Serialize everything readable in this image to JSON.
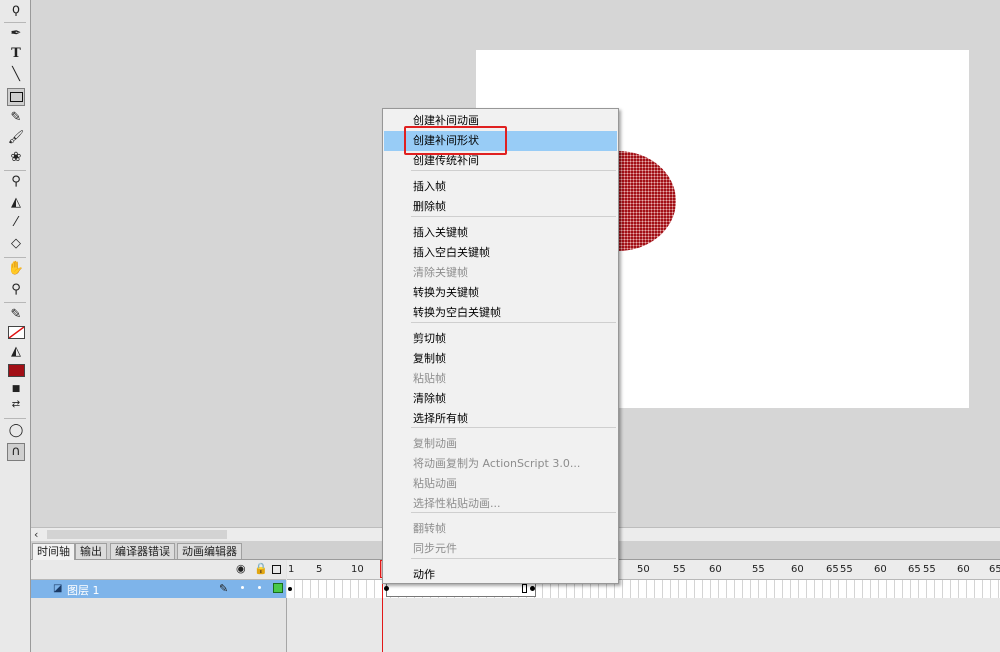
{
  "timeline": {
    "tabs": [
      "时间轴",
      "输出",
      "编译器错误",
      "动画编辑器"
    ],
    "layer_name": "图层 1",
    "ruler_numbers": [
      "1",
      "5",
      "10",
      "50",
      "55",
      "60",
      "55",
      "60",
      "65",
      "55",
      "60",
      "65",
      "55",
      "60",
      "65"
    ]
  },
  "context_menu": {
    "items": [
      {
        "label": "创建补间动画",
        "enabled": true
      },
      {
        "label": "创建补间形状",
        "enabled": true,
        "highlighted": true
      },
      {
        "label": "创建传统补间",
        "enabled": true
      },
      {
        "label": "插入帧",
        "enabled": true
      },
      {
        "label": "删除帧",
        "enabled": true
      },
      {
        "label": "插入关键帧",
        "enabled": true
      },
      {
        "label": "插入空白关键帧",
        "enabled": true
      },
      {
        "label": "清除关键帧",
        "enabled": false
      },
      {
        "label": "转换为关键帧",
        "enabled": true
      },
      {
        "label": "转换为空白关键帧",
        "enabled": true
      },
      {
        "label": "剪切帧",
        "enabled": true
      },
      {
        "label": "复制帧",
        "enabled": true
      },
      {
        "label": "粘贴帧",
        "enabled": false
      },
      {
        "label": "清除帧",
        "enabled": true
      },
      {
        "label": "选择所有帧",
        "enabled": true
      },
      {
        "label": "复制动画",
        "enabled": false
      },
      {
        "label": "将动画复制为 ActionScript 3.0...",
        "enabled": false
      },
      {
        "label": "粘贴动画",
        "enabled": false
      },
      {
        "label": "选择性粘贴动画...",
        "enabled": false
      },
      {
        "label": "翻转帧",
        "enabled": false
      },
      {
        "label": "同步元件",
        "enabled": false
      },
      {
        "label": "动作",
        "enabled": true
      }
    ]
  },
  "tools": [
    "lasso-icon",
    "pen-icon",
    "text-icon",
    "line-icon",
    "rectangle-icon",
    "pencil-icon",
    "brush-icon",
    "deco-icon",
    "bone-icon",
    "paint-bucket-icon",
    "eyedropper-icon",
    "eraser-icon",
    "hand-icon",
    "zoom-icon"
  ],
  "colors": {
    "fill": "#a20f16",
    "highlight": "#98ccf6",
    "annotation": "#e02020",
    "layer_selected": "#7eb4ea"
  }
}
